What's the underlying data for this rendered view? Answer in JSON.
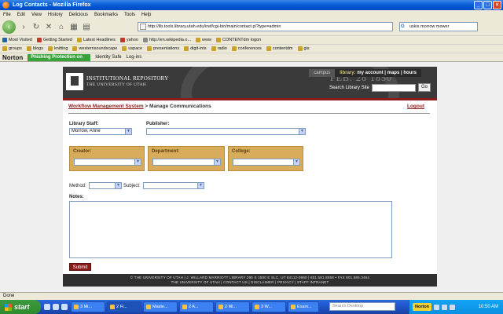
{
  "window": {
    "title": "Log Contacts - Mozilla Firefox",
    "controls": [
      "_",
      "□",
      "×"
    ]
  },
  "menu": [
    "File",
    "Edit",
    "View",
    "History",
    "Delicious",
    "Bookmarks",
    "Tools",
    "Help"
  ],
  "nav": {
    "url": "http://lib.tools.library.utah.edu/irwf/cgi-bin/main/contact.pl?type=admin",
    "search_value": "uskis morrow mower"
  },
  "bookmarks_row1": [
    "Most Visited",
    "Getting Started",
    "Latest Headlines",
    "yahoo",
    "http://en.wikipedia.o...",
    "www",
    "CONTENTdm logon"
  ],
  "bookmarks_row2": [
    "groups",
    "blogs",
    "knitting",
    "westernsoundscape",
    "uspace",
    "presentations",
    "digit-ints",
    "radio",
    "conferences",
    "contentdm",
    "gis"
  ],
  "norton": {
    "logo": "Norton",
    "phishing": "Phishing Protection on",
    "identity": "Identity Safe",
    "logins": "Log-ins"
  },
  "header": {
    "title": "INSTITUTIONAL REPOSITORY",
    "subtitle": "THE UNIVERSITY OF UTAH",
    "date_stone": "FEB. 28 1850",
    "campus": "campus",
    "library_prefix": "library:",
    "links": [
      "my account",
      "maps",
      "hours"
    ],
    "search_label": "Search Library Site",
    "go": "Go"
  },
  "breadcrumb": {
    "link": "Workflow Management System",
    "sep": " > ",
    "current": "Manage Communications"
  },
  "logout": "Logout",
  "form": {
    "library_staff_label": "Library Staff:",
    "library_staff_value": "Morrow, Anne",
    "publisher_label": "Publisher:",
    "publisher_value": "",
    "creator_label": "Creator:",
    "department_label": "Department:",
    "college_label": "College:",
    "method_label": "Method:",
    "subject_label": "Subject:",
    "notes_label": "Notes:",
    "submit": "Submit"
  },
  "footer": {
    "line1": "© THE UNIVERSITY OF UTAH | J. WILLARD MARRIOTT LIBRARY 295 S 1500 E SLC, UT 84112-0860 | 801.581.8558 • FAX 801.585.3464",
    "line2": "THE UNIVERSITY OF UTAH | CONTACT US | DISCLAIMER | PRIVACY | STAFF INTRANET"
  },
  "status": "Done",
  "taskbar": {
    "start": "start",
    "tasks": [
      "3 Mi...",
      "2 Fi...",
      "Maste...",
      "2 A...",
      "2 Mi...",
      "3 W...",
      "Exam...",
      "uskis..."
    ],
    "search_placeholder": "Search Desktop",
    "norton": "Norton",
    "clock": "10:50 AM"
  }
}
